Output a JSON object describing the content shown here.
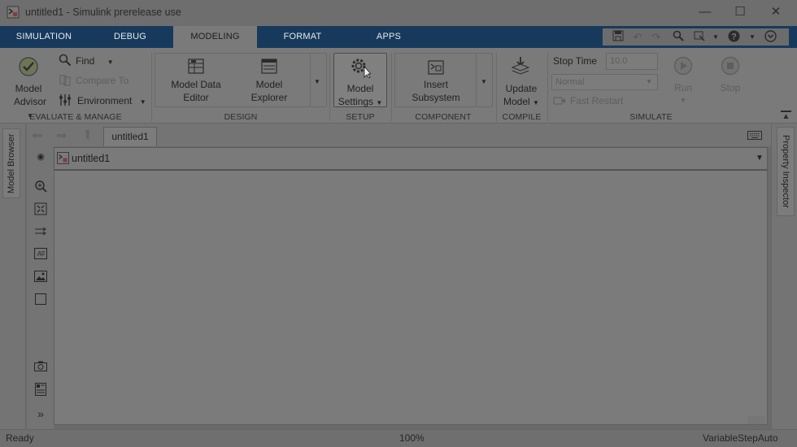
{
  "window": {
    "title": "untitled1 - Simulink prerelease use",
    "app_icon": "simulink-model-icon",
    "controls": [
      "minimize-icon",
      "maximize-icon",
      "close-icon"
    ]
  },
  "tabs": [
    {
      "label": "SIMULATION",
      "active": false
    },
    {
      "label": "DEBUG",
      "active": false
    },
    {
      "label": "MODELING",
      "active": true
    },
    {
      "label": "FORMAT",
      "active": false
    },
    {
      "label": "APPS",
      "active": false
    }
  ],
  "quick_access": [
    "save-icon",
    "undo-icon",
    "redo-icon",
    "search-icon",
    "window-icon",
    "help-icon",
    "expand-icon"
  ],
  "ribbon": {
    "evaluate": {
      "section_label": "EVALUATE & MANAGE",
      "model_advisor": {
        "line1": "Model",
        "line2": "Advisor"
      },
      "find": "Find",
      "compare_to": "Compare To",
      "environment": "Environment"
    },
    "design": {
      "section_label": "DESIGN",
      "model_data_editor": {
        "line1": "Model Data",
        "line2": "Editor"
      },
      "model_explorer": {
        "line1": "Model",
        "line2": "Explorer"
      }
    },
    "setup": {
      "section_label": "SETUP",
      "model_settings": {
        "line1": "Model",
        "line2": "Settings"
      }
    },
    "component": {
      "section_label": "COMPONENT",
      "insert_subsystem": {
        "line1": "Insert",
        "line2": "Subsystem"
      }
    },
    "compile": {
      "section_label": "COMPILE",
      "update_model": {
        "line1": "Update",
        "line2": "Model"
      }
    },
    "simulate": {
      "section_label": "SIMULATE",
      "stop_time_label": "Stop Time",
      "stop_time_value": "10.0",
      "mode_value": "Normal",
      "fast_restart": "Fast Restart",
      "run": "Run",
      "stop": "Stop"
    }
  },
  "left_panel": {
    "label": "Model Browser"
  },
  "right_panel": {
    "label": "Property Inspector"
  },
  "editor": {
    "tab_label": "untitled1",
    "address": "untitled1"
  },
  "status": {
    "left": "Ready",
    "zoom": "100%",
    "solver": "VariableStepAuto"
  }
}
